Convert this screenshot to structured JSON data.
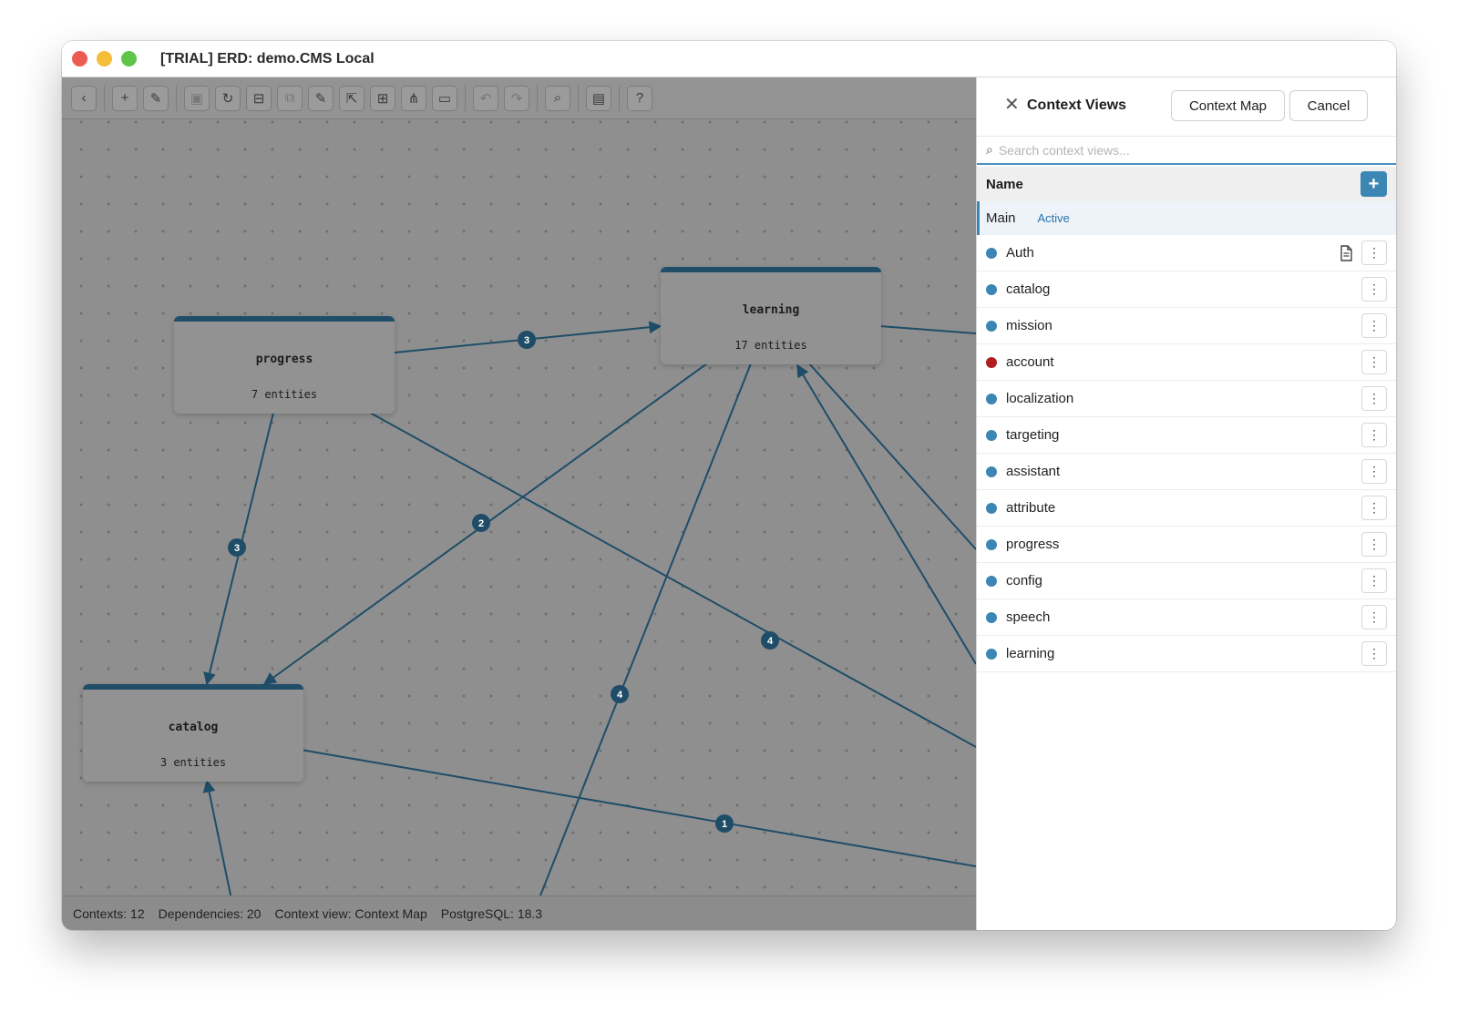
{
  "window": {
    "title": "[TRIAL] ERD: demo.CMS Local"
  },
  "toolbar": {
    "buttons": [
      {
        "name": "back-icon",
        "glyph": "‹"
      },
      {
        "name": "add-icon",
        "glyph": "+"
      },
      {
        "name": "link-icon",
        "glyph": "✎"
      },
      {
        "name": "save-icon",
        "glyph": "▣"
      },
      {
        "name": "refresh-icon",
        "glyph": "↻"
      },
      {
        "name": "layout-icon",
        "glyph": "⊟"
      },
      {
        "name": "copy-icon",
        "glyph": "⧉"
      },
      {
        "name": "edit-icon",
        "glyph": "✎"
      },
      {
        "name": "export-icon",
        "glyph": "⇱"
      },
      {
        "name": "grid-icon",
        "glyph": "⊞"
      },
      {
        "name": "hierarchy-icon",
        "glyph": "⋔"
      },
      {
        "name": "folder-icon",
        "glyph": "▭"
      },
      {
        "name": "undo-icon",
        "glyph": "↶"
      },
      {
        "name": "redo-icon",
        "glyph": "↷"
      },
      {
        "name": "search-icon",
        "glyph": "⌕"
      },
      {
        "name": "document-icon",
        "glyph": "▤"
      },
      {
        "name": "help-icon",
        "glyph": "?"
      }
    ]
  },
  "canvas": {
    "nodes": {
      "progress": {
        "title": "progress",
        "sub": "7 entities"
      },
      "learning": {
        "title": "learning",
        "sub": "17 entities"
      },
      "catalog": {
        "title": "catalog",
        "sub": "3 entities"
      }
    },
    "edge_labels": [
      "3",
      "3",
      "2",
      "4",
      "4",
      "1"
    ]
  },
  "status": {
    "contexts": "Contexts: 12",
    "dependencies": "Dependencies: 20",
    "view": "Context view: Context Map",
    "db": "PostgreSQL: 18.3"
  },
  "panel": {
    "title": "Context Views",
    "context_map_btn": "Context Map",
    "cancel_btn": "Cancel",
    "search_placeholder": "Search context views...",
    "col_name": "Name",
    "main_row": {
      "name": "Main",
      "badge": "Active"
    },
    "rows": [
      {
        "name": "Auth",
        "color": "#3c86b4"
      },
      {
        "name": "catalog",
        "color": "#3c86b4"
      },
      {
        "name": "mission",
        "color": "#3c86b4"
      },
      {
        "name": "account",
        "color": "#b01e1e"
      },
      {
        "name": "localization",
        "color": "#3c86b4"
      },
      {
        "name": "targeting",
        "color": "#3c86b4"
      },
      {
        "name": "assistant",
        "color": "#3c86b4"
      },
      {
        "name": "attribute",
        "color": "#3c86b4"
      },
      {
        "name": "progress",
        "color": "#3c86b4"
      },
      {
        "name": "config",
        "color": "#3c86b4"
      },
      {
        "name": "speech",
        "color": "#3c86b4"
      },
      {
        "name": "learning",
        "color": "#3c86b4"
      }
    ]
  }
}
